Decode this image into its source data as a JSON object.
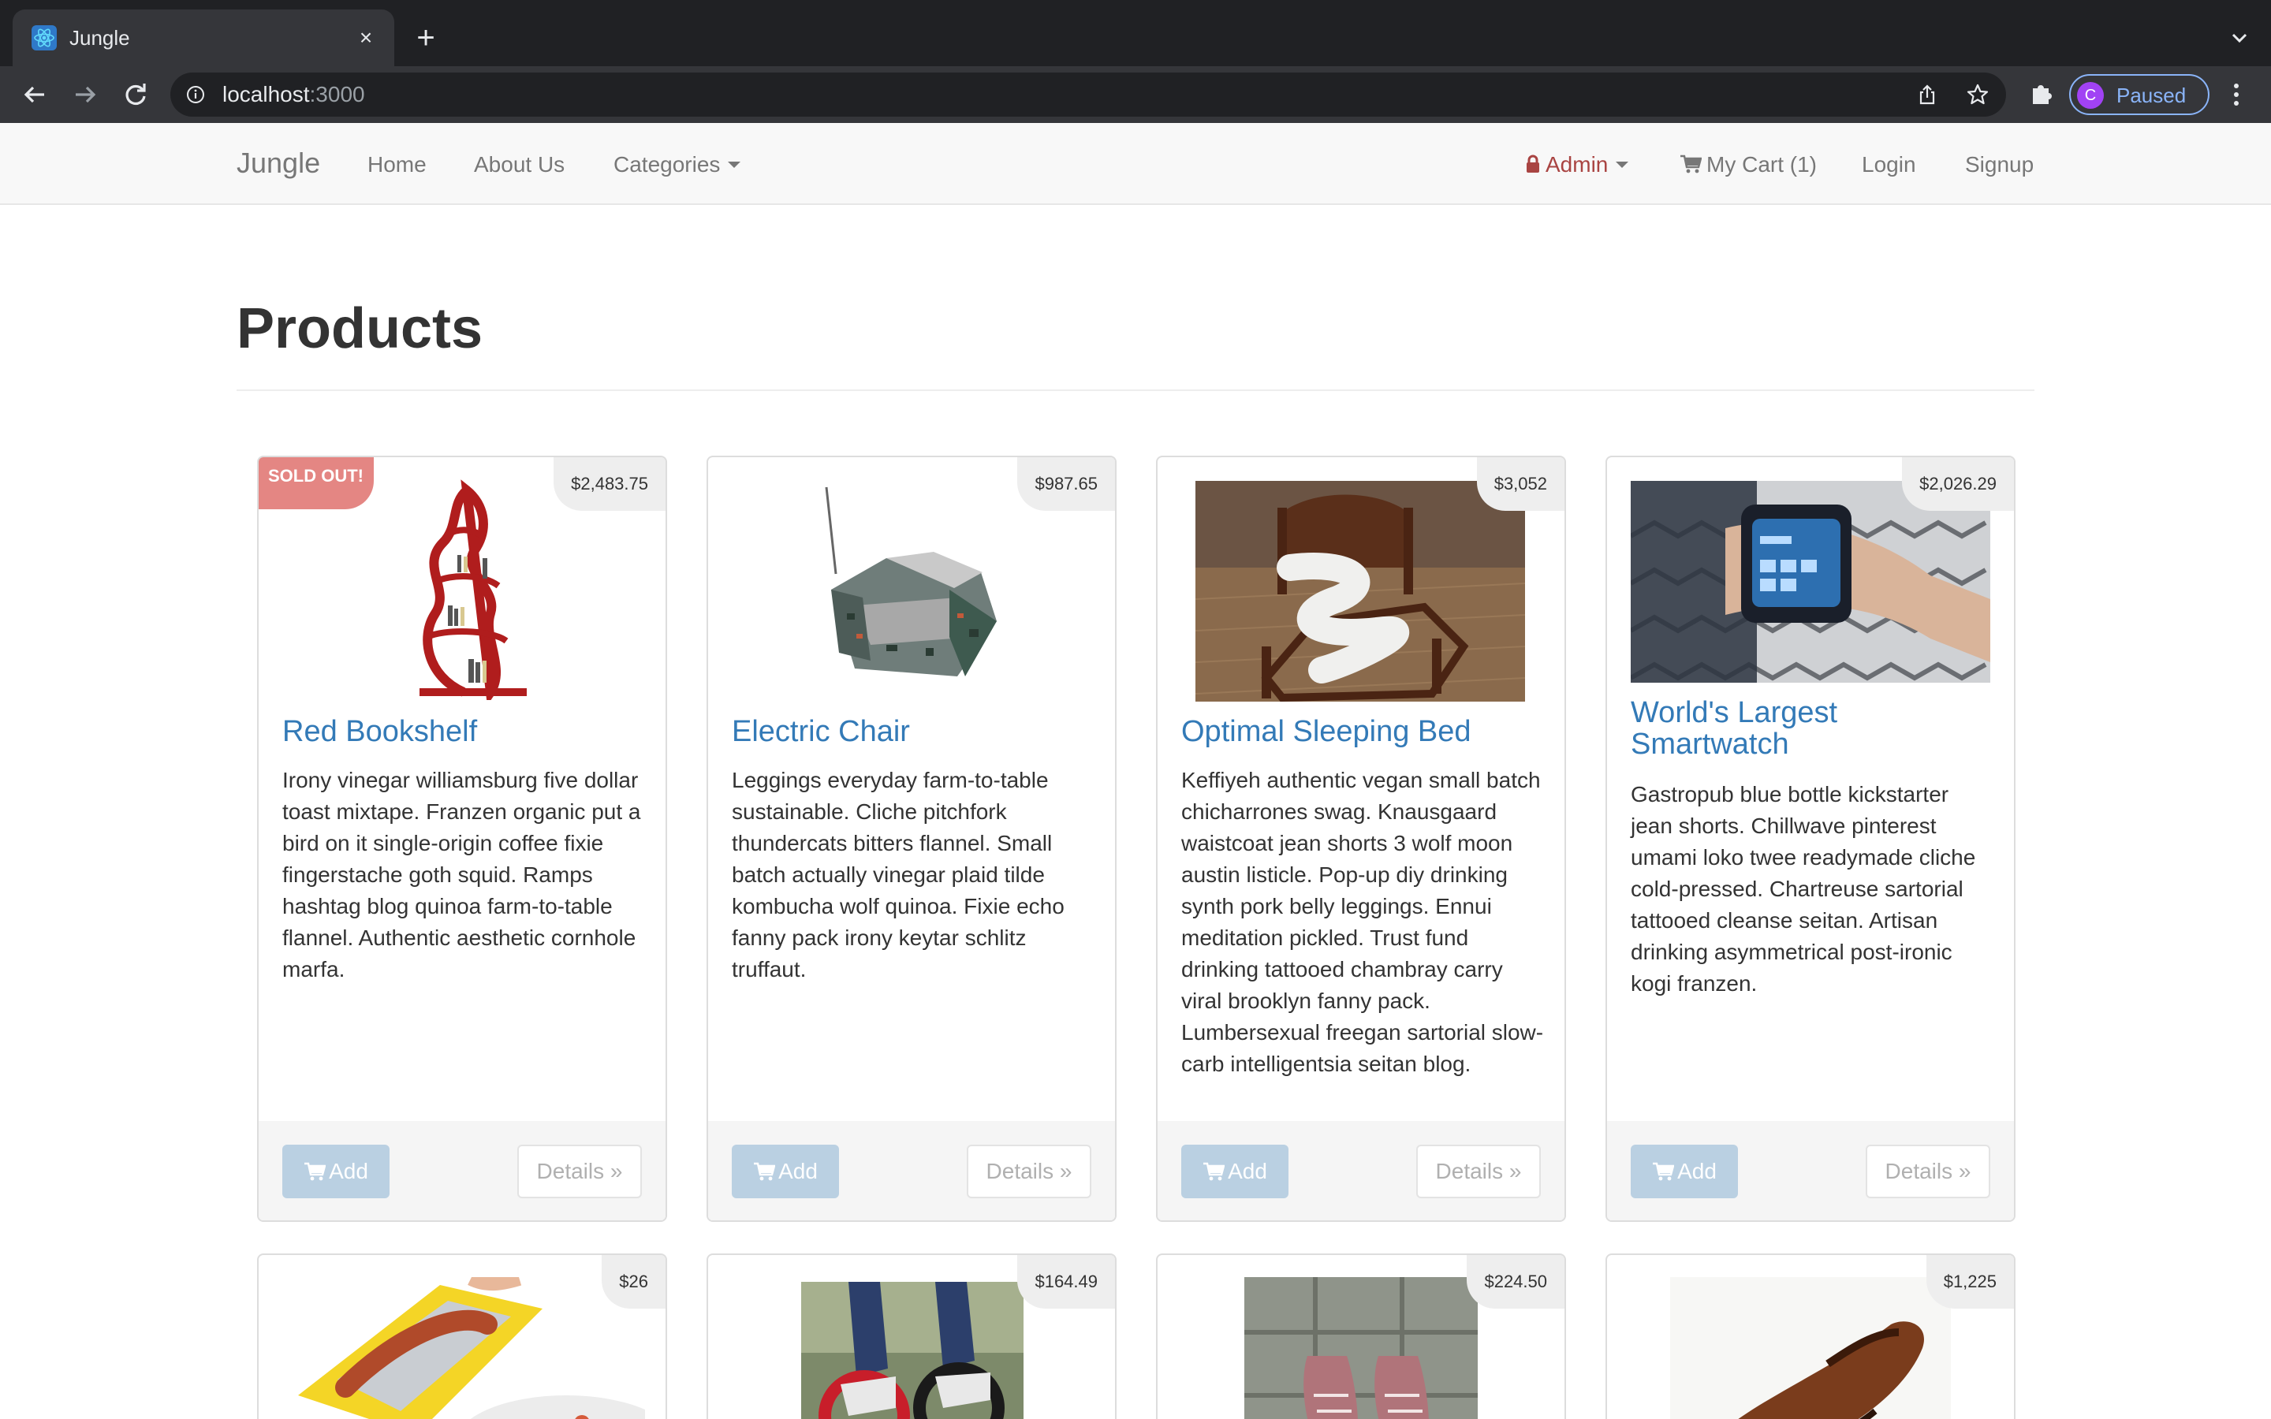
{
  "browser": {
    "tab_title": "Jungle",
    "url_host": "localhost",
    "url_port": ":3000",
    "profile_initial": "C",
    "profile_status": "Paused"
  },
  "nav": {
    "brand": "Jungle",
    "home": "Home",
    "about": "About Us",
    "categories": "Categories",
    "admin": "Admin",
    "cart": "My Cart (1)",
    "login": "Login",
    "signup": "Signup"
  },
  "page": {
    "title": "Products"
  },
  "products": [
    {
      "name": "Red Bookshelf",
      "price": "$2,483.75",
      "sold_out": "SOLD OUT!",
      "description": "Irony vinegar williamsburg five dollar toast mixtape. Franzen organic put a bird on it single-origin coffee fixie fingerstache goth squid. Ramps hashtag blog quinoa farm-to-table flannel. Authentic aesthetic cornhole marfa.",
      "add_label": "Add",
      "details_label": "Details »"
    },
    {
      "name": "Electric Chair",
      "price": "$987.65",
      "description": "Leggings everyday farm-to-table sustainable. Cliche pitchfork thundercats bitters flannel. Small batch actually vinegar plaid tilde kombucha wolf quinoa. Fixie echo fanny pack irony keytar schlitz truffaut.",
      "add_label": "Add",
      "details_label": "Details »"
    },
    {
      "name": "Optimal Sleeping Bed",
      "price": "$3,052",
      "description": "Keffiyeh authentic vegan small batch chicharrones swag. Knausgaard waistcoat jean shorts 3 wolf moon austin listicle. Pop-up diy drinking synth pork belly leggings. Ennui meditation pickled. Trust fund drinking tattooed chambray carry viral brooklyn fanny pack. Lumbersexual freegan sartorial slow-carb intelligentsia seitan blog.",
      "add_label": "Add",
      "details_label": "Details »"
    },
    {
      "name": "World's Largest Smartwatch",
      "price": "$2,026.29",
      "description": "Gastropub blue bottle kickstarter jean shorts. Chillwave pinterest umami loko twee readymade cliche cold-pressed. Chartreuse sartorial tattooed cleanse seitan. Artisan drinking asymmetrical post-ironic kogi franzen.",
      "add_label": "Add",
      "details_label": "Details »"
    },
    {
      "price": "$26"
    },
    {
      "price": "$164.49"
    },
    {
      "price": "$224.50"
    },
    {
      "price": "$1,225"
    }
  ],
  "colors": {
    "link_blue": "#337ab7",
    "sold_out_red": "#d9534f",
    "admin_red": "#a94442",
    "navbar_bg": "#f8f8f8"
  }
}
